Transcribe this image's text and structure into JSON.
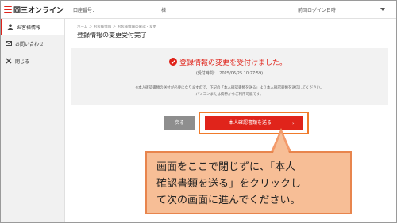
{
  "header": {
    "logo": "岡三オンライン",
    "account_label": "口座番号：",
    "honorific": "様",
    "last_login_label": "前回ログイン日時："
  },
  "sidebar": {
    "items": [
      {
        "label": "お客様情報",
        "icon": "person-icon",
        "active": true
      },
      {
        "label": "お問い合わせ",
        "icon": "mail-icon",
        "active": false
      },
      {
        "label": "閉じる",
        "icon": "close-icon",
        "active": false
      }
    ]
  },
  "breadcrumb": "ホーム ＞ お客様情報 ＞ お客様情報の確認・変更",
  "page_title": "登録情報の変更受付完了",
  "message": {
    "done": "登録情報の変更を受付けました。",
    "timestamp": "(受付時間：　2025/06/25 10:27:59)",
    "note_line1": "※本人確認書類の送付が必要になりますので、下記の「本人確認書類を送る」より本人確認書類を送信してください。",
    "note_line2": "パソコンまたは携帯からご利用可能です。"
  },
  "buttons": {
    "back": "戻る",
    "send": "本人確認書類を送る",
    "send_chevron": "›"
  },
  "callout": {
    "line1": "画面をここで閉じずに、「本人",
    "line2": "確認書類を送る」をクリックし",
    "line3": "て次の画面に進んでください。"
  },
  "colors": {
    "accent": "#e0241b",
    "callout_bg": "#f7be96",
    "callout_border": "#e8854d",
    "highlight_frame": "#f07b2b"
  }
}
